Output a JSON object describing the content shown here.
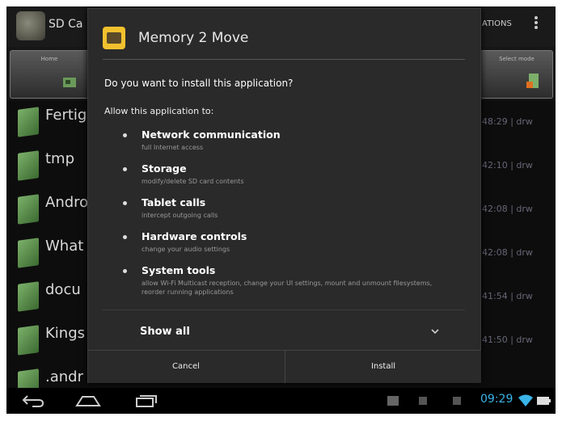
{
  "app": {
    "title": "SD Ca",
    "menu_text": "ATIONS",
    "toolbar": {
      "left_label": "Home",
      "right_label": "Select mode"
    }
  },
  "files": [
    {
      "name": "Fertig",
      "meta": "48:29 | drw"
    },
    {
      "name": "tmp",
      "meta": "42:10 | drw"
    },
    {
      "name": "Andro",
      "meta": "42:08 | drw"
    },
    {
      "name": "What",
      "meta": "42:08 | drw"
    },
    {
      "name": "docu",
      "meta": "41:54 | drw"
    },
    {
      "name": "Kings",
      "meta": "41:50 | drw"
    },
    {
      "name": ".andr",
      "meta": ""
    }
  ],
  "dialog": {
    "title": "Memory 2 Move",
    "question": "Do you want to install this application?",
    "allow": "Allow this application to:",
    "permissions": [
      {
        "title": "Network communication",
        "desc": "full Internet access"
      },
      {
        "title": "Storage",
        "desc": "modify/delete SD card contents"
      },
      {
        "title": "Tablet calls",
        "desc": "intercept outgoing calls"
      },
      {
        "title": "Hardware controls",
        "desc": "change your audio settings"
      },
      {
        "title": "System tools",
        "desc": "allow Wi-Fi Multicast reception, change your UI settings, mount and unmount filesystems, reorder running applications"
      }
    ],
    "show_all": "Show all",
    "cancel": "Cancel",
    "install": "Install"
  },
  "status": {
    "time": "09:29"
  },
  "colors": {
    "accent": "#3ab4e8",
    "dialog_bg": "#2a2a2a",
    "folder": "#5a8a4a"
  }
}
